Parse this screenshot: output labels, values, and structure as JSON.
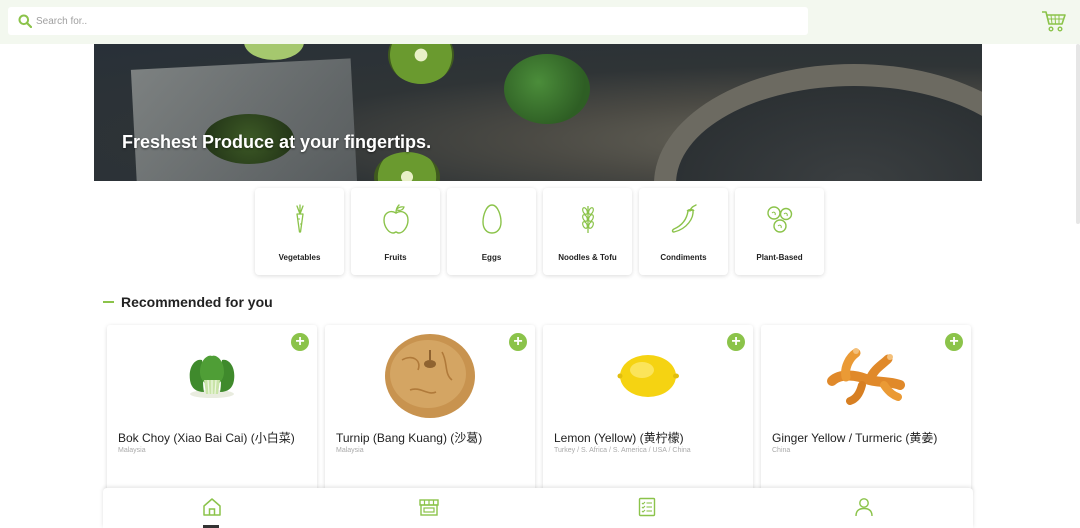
{
  "search": {
    "placeholder": "Search for.."
  },
  "hero": {
    "title": "Freshest Produce at your fingertips."
  },
  "categories": [
    {
      "label": "Vegetables",
      "icon": "carrot-icon"
    },
    {
      "label": "Fruits",
      "icon": "apple-icon"
    },
    {
      "label": "Eggs",
      "icon": "egg-icon"
    },
    {
      "label": "Noodles & Tofu",
      "icon": "wheat-icon"
    },
    {
      "label": "Condiments",
      "icon": "chili-icon"
    },
    {
      "label": "Plant-Based",
      "icon": "beans-icon"
    }
  ],
  "recommended": {
    "title": "Recommended for you",
    "items": [
      {
        "name": "Bok Choy (Xiao Bai Cai) (小白菜)",
        "origin": "Malaysia"
      },
      {
        "name": "Turnip (Bang Kuang) (沙葛)",
        "origin": "Malaysia"
      },
      {
        "name": "Lemon (Yellow) (黄柠檬)",
        "origin": "Turkey / S. Africa / S. America / USA / China"
      },
      {
        "name": "Ginger Yellow / Turmeric (黄姜)",
        "origin": "China"
      }
    ],
    "add_label": "+"
  },
  "nav": [
    {
      "icon": "home-icon",
      "active": true
    },
    {
      "icon": "store-icon",
      "active": false
    },
    {
      "icon": "orders-icon",
      "active": false
    },
    {
      "icon": "profile-icon",
      "active": false
    }
  ],
  "colors": {
    "accent": "#8bc34a",
    "topbar": "#f3f8ef"
  }
}
